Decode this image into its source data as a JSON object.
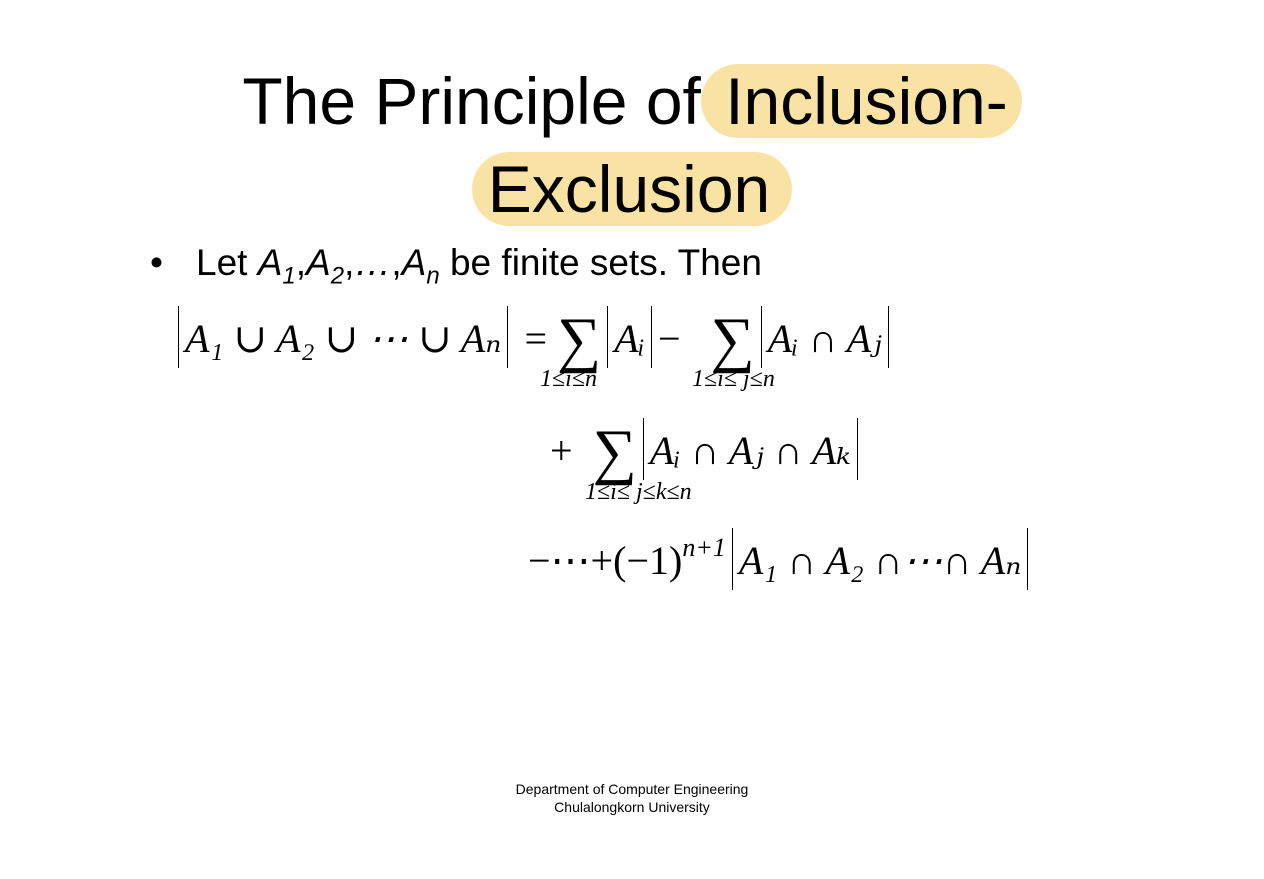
{
  "slide": {
    "title_line1_prefix": "The Principle of",
    "title_line1_highlight": " Inclusion-",
    "title_line2_highlight": "Exclusion",
    "bullet": {
      "marker": "•",
      "text_before": "Let",
      "sets_text": "A",
      "sub1": "1",
      "sub2": "2",
      "ellipsis": "…",
      "subn": "n",
      "text_after": "be finite sets. Then"
    },
    "formula": {
      "line1_lhs": "A₁ ∪ A₂ ∪ ⋯ ∪ Aₙ",
      "line1_eq": "=",
      "line1_sum1_term": "Aᵢ",
      "line1_sum1_limit": "1≤i≤n",
      "line1_minus": "−",
      "line1_sum2_term": "Aᵢ ∩ Aⱼ",
      "line1_sum2_limit": "1≤i≤ j≤n",
      "line2_plus": "+",
      "line2_sum_term": "Aᵢ ∩ Aⱼ ∩ Aₖ",
      "line2_sum_limit": "1≤i≤ j≤k≤n",
      "line3_prefix": "−⋯+(−1)",
      "line3_exponent": "n+1",
      "line3_term": "A₁ ∩ A₂ ∩⋯∩ Aₙ"
    },
    "footer": {
      "line1": "Department of Computer Engineering",
      "line2": "Chulalongkorn University"
    },
    "colors": {
      "highlight": "#f9e3a4"
    }
  }
}
